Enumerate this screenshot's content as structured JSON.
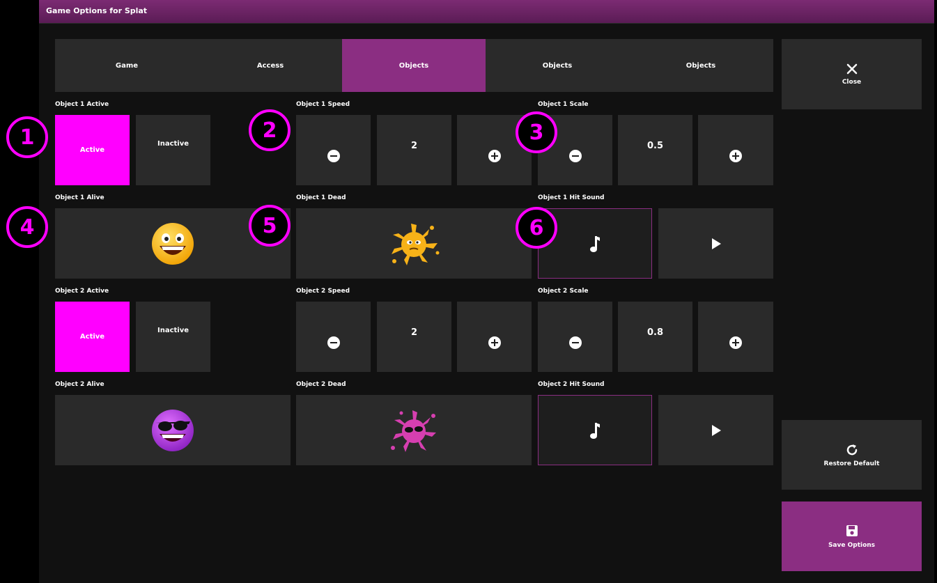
{
  "window": {
    "title": "Game Options for Splat"
  },
  "tabs": [
    {
      "label": "Game"
    },
    {
      "label": "Access"
    },
    {
      "label": "Objects",
      "active": true
    },
    {
      "label": "Objects"
    },
    {
      "label": "Objects"
    }
  ],
  "sidebar": {
    "close_label": "Close",
    "restore_label": "Restore Default",
    "save_label": "Save Options"
  },
  "object1": {
    "active_label": "Object 1 Active",
    "active_option": "Active",
    "inactive_option": "Inactive",
    "speed_label": "Object 1 Speed",
    "speed_value": "2",
    "scale_label": "Object 1 Scale",
    "scale_value": "0.5",
    "alive_label": "Object 1 Alive",
    "dead_label": "Object 1 Dead",
    "hit_sound_label": "Object 1 Hit Sound"
  },
  "object2": {
    "active_label": "Object 2 Active",
    "active_option": "Active",
    "inactive_option": "Inactive",
    "speed_label": "Object 2 Speed",
    "speed_value": "2",
    "scale_label": "Object 2 Scale",
    "scale_value": "0.8",
    "alive_label": "Object 2 Alive",
    "dead_label": "Object 2 Dead",
    "hit_sound_label": "Object 2 Hit Sound"
  },
  "callouts": [
    "1",
    "2",
    "3",
    "4",
    "5",
    "6"
  ],
  "colors": {
    "accent": "#8b2e82",
    "active": "#ff00ff",
    "tile": "#2a2a2a",
    "background": "#111111"
  },
  "icons": [
    "close-icon",
    "minus-icon",
    "plus-icon",
    "music-note-icon",
    "play-icon",
    "refresh-icon",
    "save-icon"
  ]
}
